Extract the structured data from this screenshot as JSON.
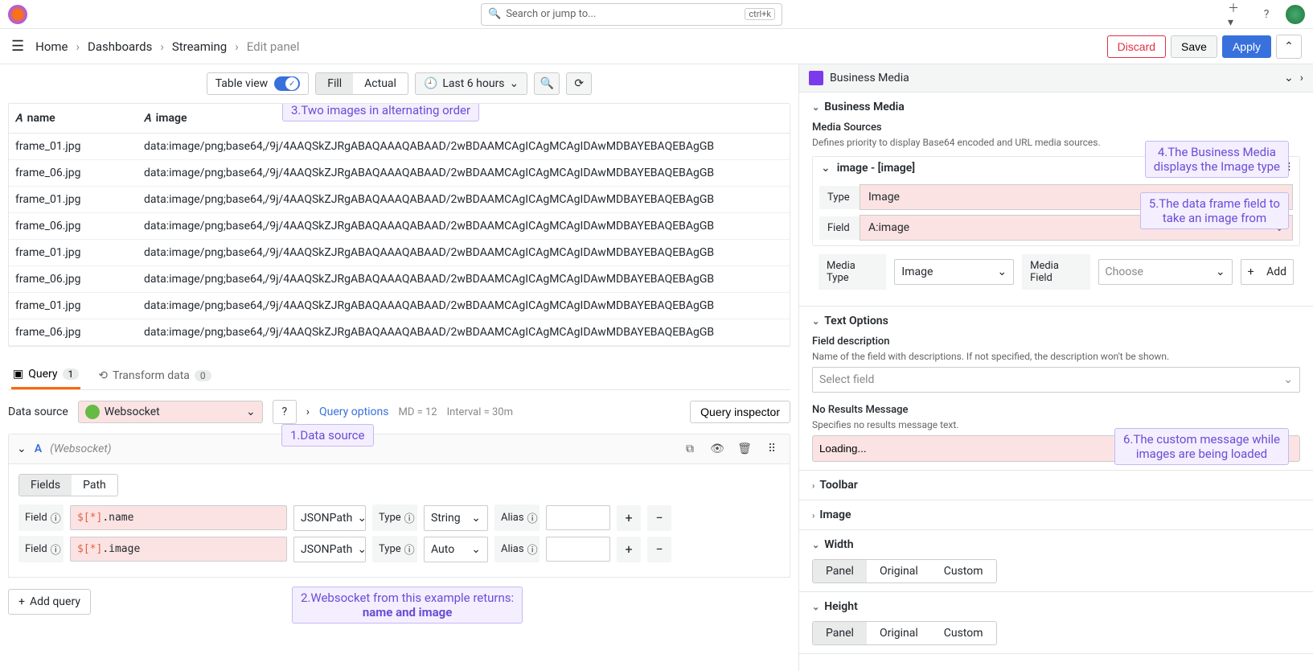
{
  "search": {
    "placeholder": "Search or jump to...",
    "kbd": "ctrl+k"
  },
  "breadcrumbs": {
    "home": "Home",
    "dash": "Dashboards",
    "stream": "Streaming",
    "edit": "Edit panel"
  },
  "actions": {
    "discard": "Discard",
    "save": "Save",
    "apply": "Apply"
  },
  "toolbar": {
    "tableview": "Table view",
    "fill": "Fill",
    "actual": "Actual",
    "time": "Last 6 hours"
  },
  "table": {
    "col_name": "name",
    "col_image": "image",
    "rows": [
      {
        "name": "frame_01.jpg",
        "image": "data:image/png;base64,/9j/4AAQSkZJRgABAQAAAQABAAD/2wBDAAMCAgICAgMCAgIDAwMDBAYEBAQEBAgGB"
      },
      {
        "name": "frame_06.jpg",
        "image": "data:image/png;base64,/9j/4AAQSkZJRgABAQAAAQABAAD/2wBDAAMCAgICAgMCAgIDAwMDBAYEBAQEBAgGB"
      },
      {
        "name": "frame_01.jpg",
        "image": "data:image/png;base64,/9j/4AAQSkZJRgABAQAAAQABAAD/2wBDAAMCAgICAgMCAgIDAwMDBAYEBAQEBAgGB"
      },
      {
        "name": "frame_06.jpg",
        "image": "data:image/png;base64,/9j/4AAQSkZJRgABAQAAAQABAAD/2wBDAAMCAgICAgMCAgIDAwMDBAYEBAQEBAgGB"
      },
      {
        "name": "frame_01.jpg",
        "image": "data:image/png;base64,/9j/4AAQSkZJRgABAQAAAQABAAD/2wBDAAMCAgICAgMCAgIDAwMDBAYEBAQEBAgGB"
      },
      {
        "name": "frame_06.jpg",
        "image": "data:image/png;base64,/9j/4AAQSkZJRgABAQAAAQABAAD/2wBDAAMCAgICAgMCAgIDAwMDBAYEBAQEBAgGB"
      },
      {
        "name": "frame_01.jpg",
        "image": "data:image/png;base64,/9j/4AAQSkZJRgABAQAAAQABAAD/2wBDAAMCAgICAgMCAgIDAwMDBAYEBAQEBAgGB"
      },
      {
        "name": "frame_06.jpg",
        "image": "data:image/png;base64,/9j/4AAQSkZJRgABAQAAAQABAAD/2wBDAAMCAgICAgMCAgIDAwMDBAYEBAQEBAgGB"
      }
    ]
  },
  "tabs": {
    "query": "Query",
    "query_count": "1",
    "transform": "Transform data",
    "transform_count": "0"
  },
  "ds": {
    "label": "Data source",
    "value": "Websocket",
    "qopts": "Query options",
    "md": "MD = 12",
    "interval": "Interval = 30m",
    "inspector": "Query inspector"
  },
  "qrow": {
    "id": "A",
    "hint": "(Websocket)",
    "fields": "Fields",
    "path": "Path",
    "field": "Field",
    "jsonpath": "JSONPath",
    "type": "Type",
    "string": "String",
    "auto": "Auto",
    "alias": "Alias",
    "f1": "$[*].name",
    "f2": "$[*].image",
    "addq": "Add query"
  },
  "annotations": {
    "a1": "1.Data source",
    "a2_l1": "2.Websocket from this example returns:",
    "a2_l2": "name and image",
    "a3": "3.Two images in alternating order",
    "a4_l1": "4.The Business Media",
    "a4_l2": "displays the Image type",
    "a5_l1": "5.The data frame field to",
    "a5_l2": "take an image from",
    "a6_l1": "6.The custom message while",
    "a6_l2": "images are being loaded"
  },
  "right": {
    "panel_name": "Business Media",
    "sec_bm": "Business Media",
    "media_sources": "Media Sources",
    "media_sources_desc": "Defines priority to display Base64 encoded and URL media sources.",
    "src_title": "image - [image]",
    "type_label": "Type",
    "type_val": "Image",
    "field_label": "Field",
    "field_val": "A:image",
    "mtype_label": "Media Type",
    "mtype_val": "Image",
    "mfield_label": "Media Field",
    "mfield_val": "Choose",
    "add": "Add",
    "text_options": "Text Options",
    "fd_label": "Field description",
    "fd_desc": "Name of the field with descriptions. If not specified, the description won't be shown.",
    "fd_ph": "Select field",
    "nrm_label": "No Results Message",
    "nrm_desc": "Specifies no results message text.",
    "nrm_val": "Loading...",
    "toolbar": "Toolbar",
    "image": "Image",
    "width": "Width",
    "height": "Height",
    "panel": "Panel",
    "original": "Original",
    "custom": "Custom"
  }
}
